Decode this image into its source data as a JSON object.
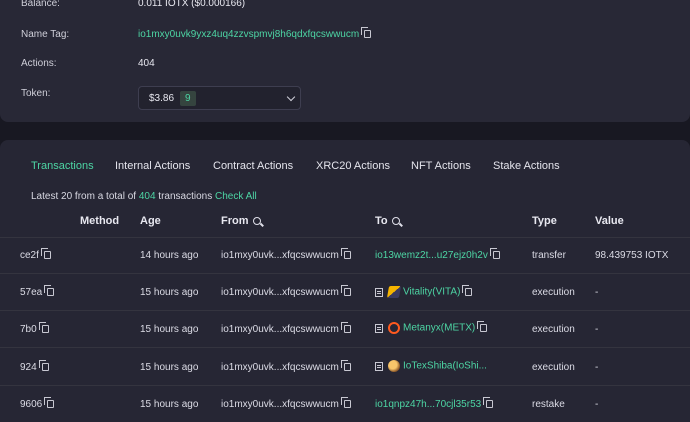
{
  "overview": {
    "balance_label": "Balance:",
    "balance_value": "0.011 IOTX  ($0.000166)",
    "name_tag_label": "Name Tag:",
    "name_tag_value": "io1mxy0uvk9yxz4uq4zzvspmvj8h6qdxfqcswwucm",
    "actions_label": "Actions:",
    "actions_value": "404",
    "token_label": "Token:",
    "token_value": "$3.86",
    "token_count": "9"
  },
  "tabs": [
    "Transactions",
    "Internal Actions",
    "Contract Actions",
    "XRC20 Actions",
    "NFT Actions",
    "Stake Actions"
  ],
  "summary": {
    "prefix": "Latest 20 from a total of ",
    "total": "404",
    "suffix": " transactions ",
    "link": "Check All"
  },
  "table": {
    "headers": {
      "method": "Method",
      "age": "Age",
      "from": "From",
      "to": "To",
      "type": "Type",
      "value": "Value"
    },
    "rows": [
      {
        "hash": "ce2f",
        "age": "14 hours ago",
        "from": "io1mxy0uvk...xfqcswwucm",
        "to": "io13wemz2t...u27ejz0h2v",
        "to_kind": "address",
        "type": "transfer",
        "value": "98.439753 IOTX"
      },
      {
        "hash": "57ea",
        "age": "15 hours ago",
        "from": "io1mxy0uvk...xfqcswwucm",
        "to": "Vitality(VITA)",
        "to_kind": "token",
        "token_logo": "vita-logo-icon",
        "type": "execution",
        "value": "-"
      },
      {
        "hash": "7b0",
        "age": "15 hours ago",
        "from": "io1mxy0uvk...xfqcswwucm",
        "to": "Metanyx(METX)",
        "to_kind": "token",
        "token_logo": "metx-logo-icon",
        "type": "execution",
        "value": "-"
      },
      {
        "hash": "924",
        "age": "15 hours ago",
        "from": "io1mxy0uvk...xfqcswwucm",
        "to": "IoTexShiba(IoShi...",
        "to_kind": "token",
        "token_logo": "shiba-logo-icon",
        "type": "execution",
        "value": "-"
      },
      {
        "hash": "9606",
        "age": "15 hours ago",
        "from": "io1mxy0uvk...xfqcswwucm",
        "to": "io1qnpz47h...70cjl35r53",
        "to_kind": "address",
        "type": "restake",
        "value": "-"
      }
    ]
  },
  "colors": {
    "accent": "#4dd5a4",
    "page_bg": "#181822",
    "card_bg": "#262634"
  }
}
